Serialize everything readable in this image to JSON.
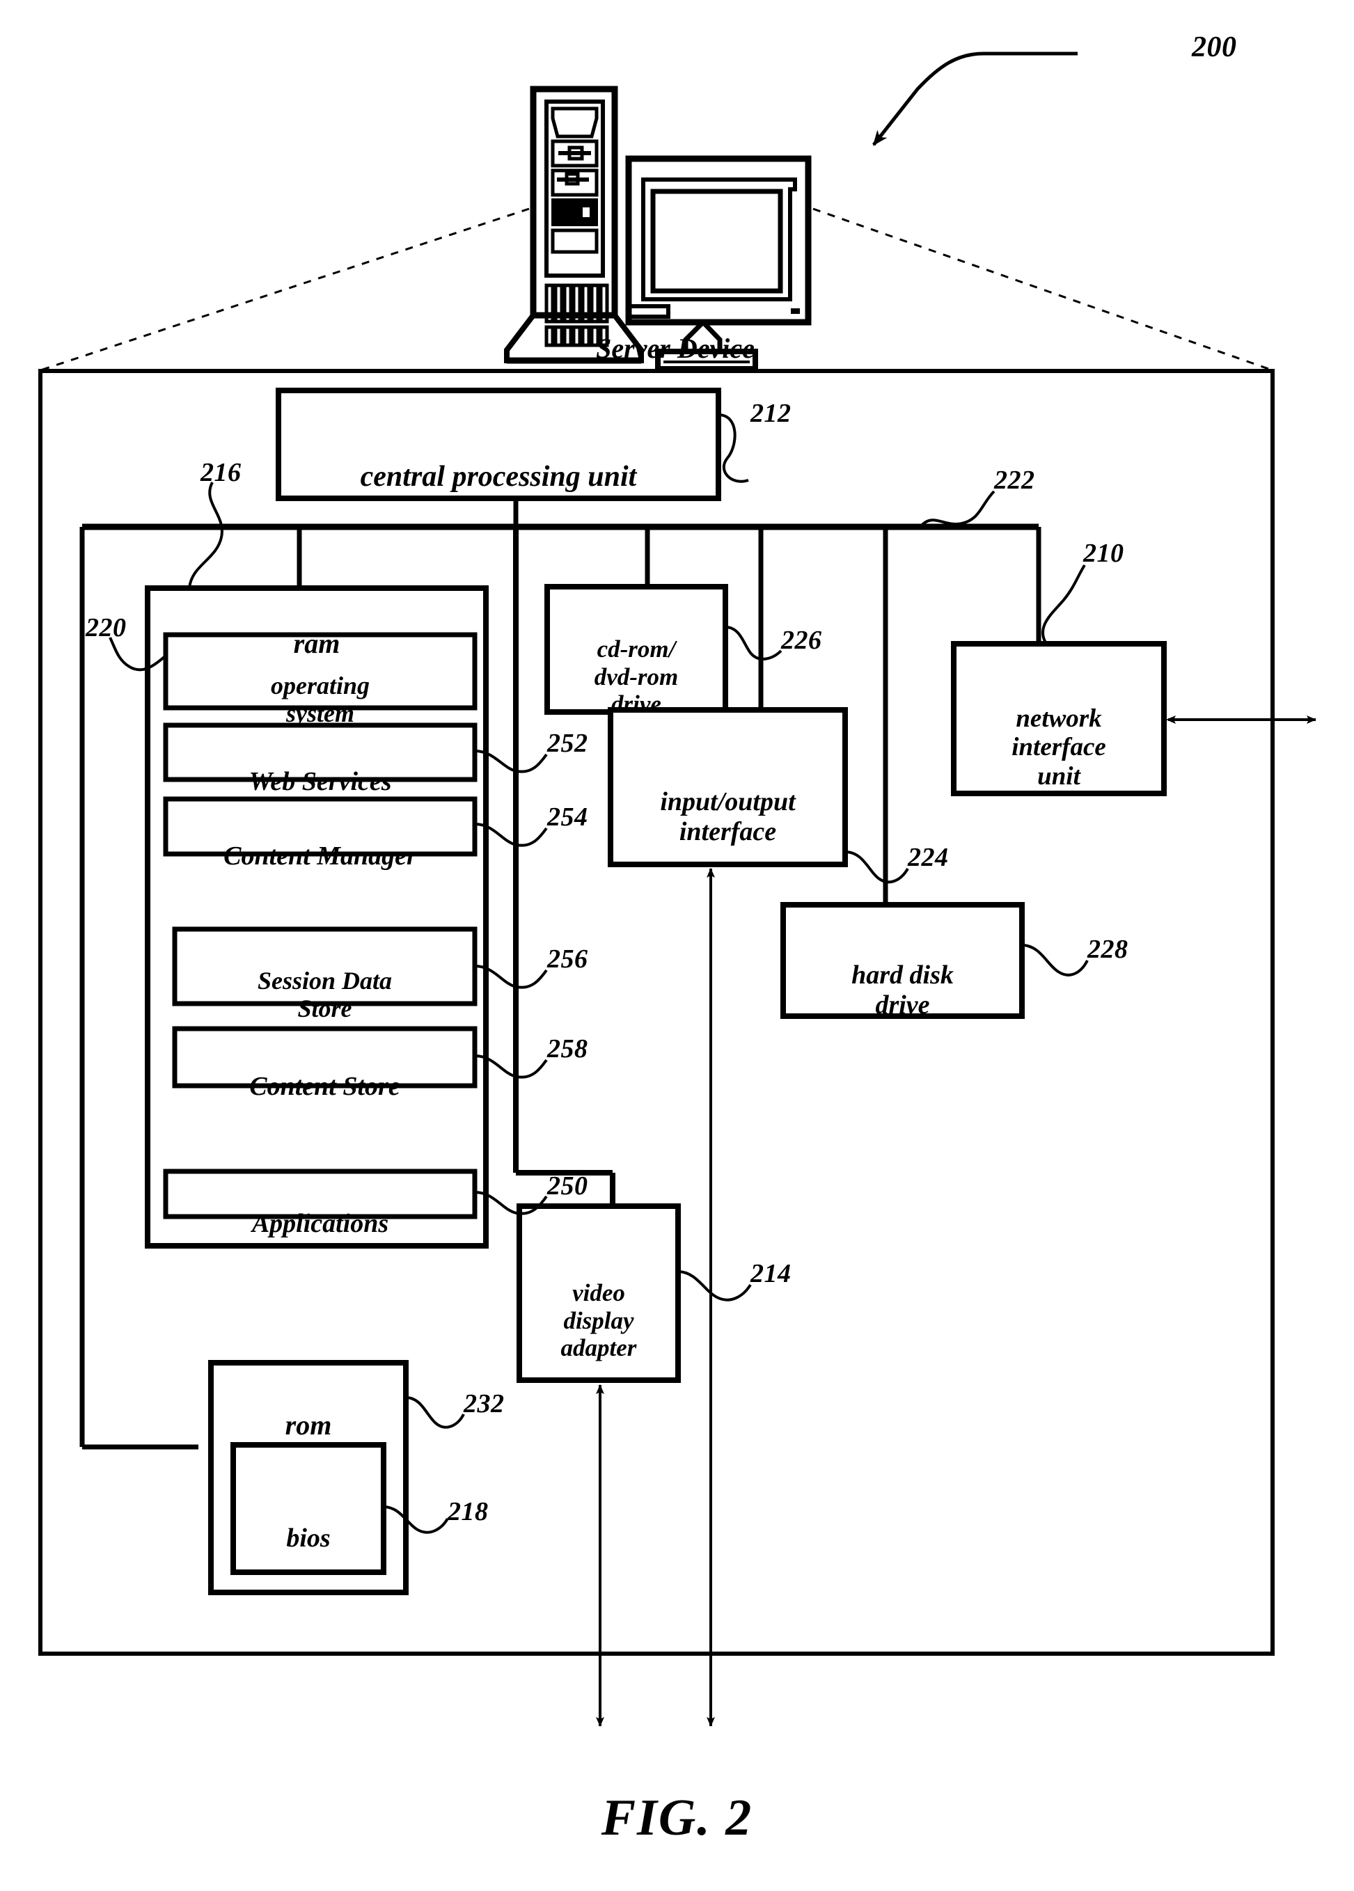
{
  "figure": {
    "caption": "FIG. 2",
    "top_reference": "200",
    "device_caption": "Server Device"
  },
  "boxes": {
    "cpu": {
      "label": "central processing unit",
      "ref": "212"
    },
    "ram": {
      "label": "ram",
      "ref": "216"
    },
    "operating_system": {
      "label": "operating\nsystem",
      "ref": "220"
    },
    "web_services": {
      "label": "Web Services",
      "ref": "252"
    },
    "content_manager": {
      "label": "Content Manager",
      "ref": "254"
    },
    "session_data_store": {
      "label": "Session Data\nStore",
      "ref": "256"
    },
    "content_store": {
      "label": "Content Store",
      "ref": "258"
    },
    "applications": {
      "label": "Applications",
      "ref": "250"
    },
    "cdrom_drive": {
      "label": "cd-rom/\ndvd-rom\ndrive",
      "ref": "226"
    },
    "io_interface": {
      "label": "input/output\ninterface",
      "ref": "224"
    },
    "network_interface_unit": {
      "label": "network\ninterface\nunit",
      "ref": "210"
    },
    "hard_disk_drive": {
      "label": "hard disk\ndrive",
      "ref": "228"
    },
    "video_display_adapter": {
      "label": "video\ndisplay\nadapter",
      "ref": "214"
    },
    "rom": {
      "label": "rom",
      "ref": "232"
    },
    "bios": {
      "label": "bios",
      "ref": "218"
    },
    "bus": {
      "ref": "222"
    }
  },
  "reference_numerals": [
    "200",
    "210",
    "212",
    "214",
    "216",
    "218",
    "220",
    "222",
    "224",
    "226",
    "228",
    "232",
    "250",
    "252",
    "254",
    "256",
    "258"
  ],
  "colors": {
    "stroke": "#000000",
    "background": "#ffffff"
  }
}
